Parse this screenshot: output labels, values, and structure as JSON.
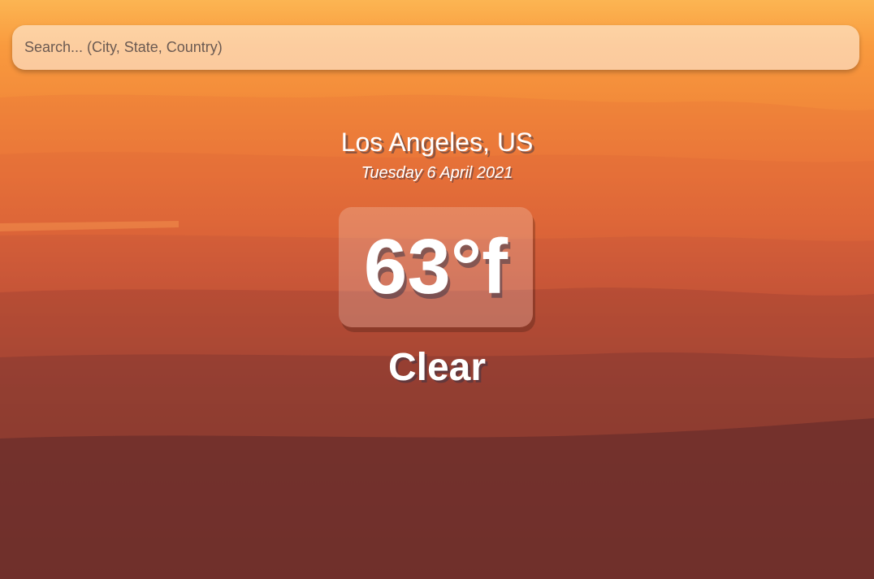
{
  "search": {
    "placeholder": "Search... (City, State, Country)",
    "value": ""
  },
  "location": {
    "city_country": "Los Angeles, US",
    "date": "Tuesday 6 April 2021"
  },
  "weather": {
    "temperature": "63°f",
    "condition": "Clear"
  }
}
